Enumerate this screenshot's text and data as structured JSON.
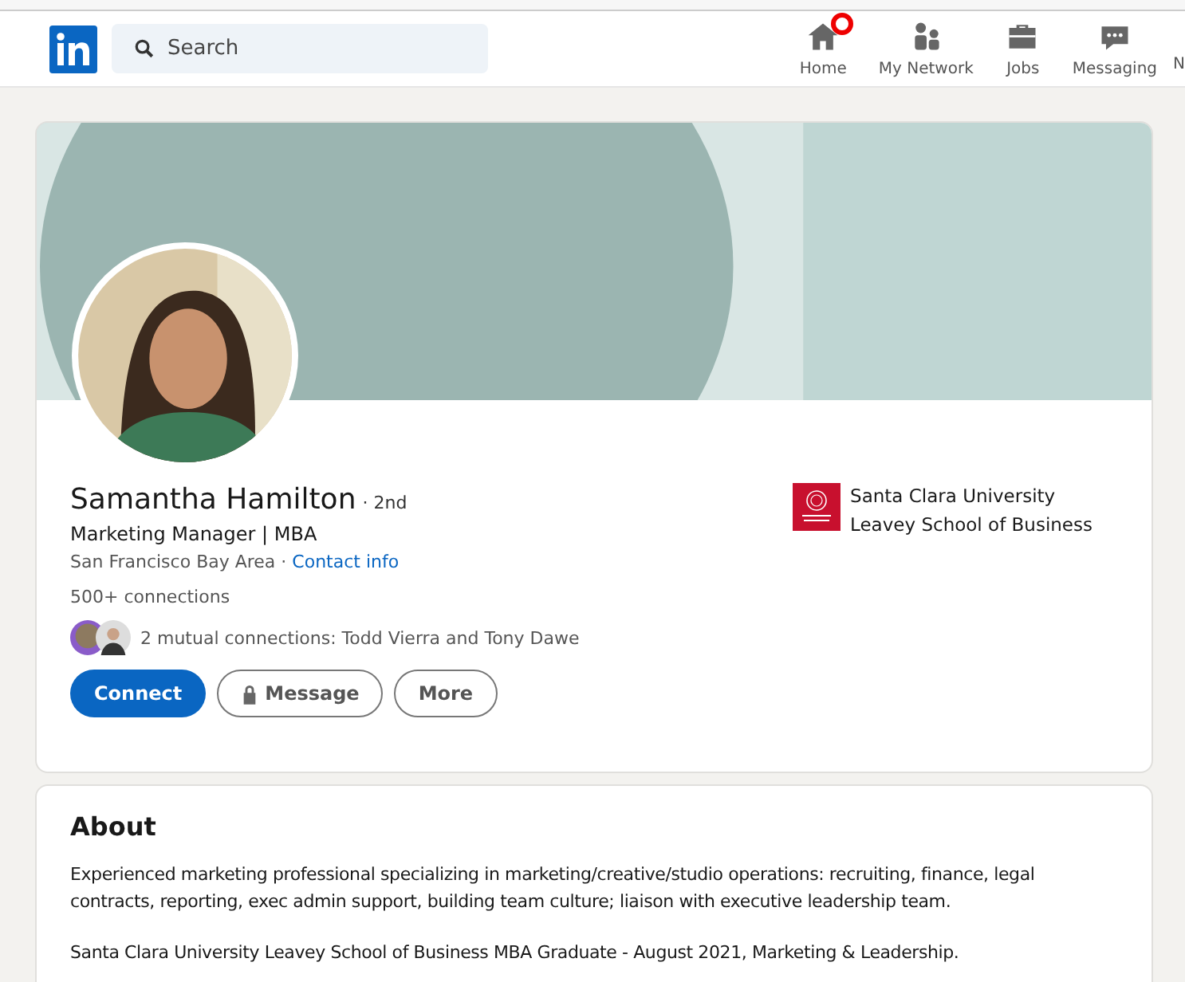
{
  "header": {
    "search": {
      "placeholder": "Search"
    },
    "nav": [
      {
        "kind": "home",
        "label": "Home",
        "notification": true
      },
      {
        "kind": "network",
        "label": "My Network",
        "notification": false
      },
      {
        "kind": "jobs",
        "label": "Jobs",
        "notification": false
      },
      {
        "kind": "messaging",
        "label": "Messaging",
        "notification": false
      },
      {
        "kind": "cut",
        "label": "N",
        "notification": false
      }
    ]
  },
  "profile": {
    "name": "Samantha Hamilton",
    "degree": "· 2nd",
    "headline": "Marketing Manager | MBA",
    "location": "San Francisco Bay Area ·",
    "contact_link": "Contact info",
    "connections": "500+ connections",
    "mutual": "2 mutual connections: Todd Vierra and Tony Dawe",
    "school": [
      "Santa Clara University",
      "Leavey School of Business"
    ],
    "buttons": [
      {
        "kind": "primary",
        "label": "Connect"
      },
      {
        "kind": "locked",
        "label": "Message"
      },
      {
        "kind": "outline",
        "label": "More"
      }
    ]
  },
  "about": {
    "title": "About",
    "paragraphs": [
      "Experienced marketing professional specializing in marketing/creative/studio operations: recruiting, finance, legal contracts, reporting, exec admin support, building team culture; liaison with executive leadership team.",
      "Santa Clara University Leavey School of Business MBA Graduate - August 2021, Marketing & Leadership."
    ]
  }
}
